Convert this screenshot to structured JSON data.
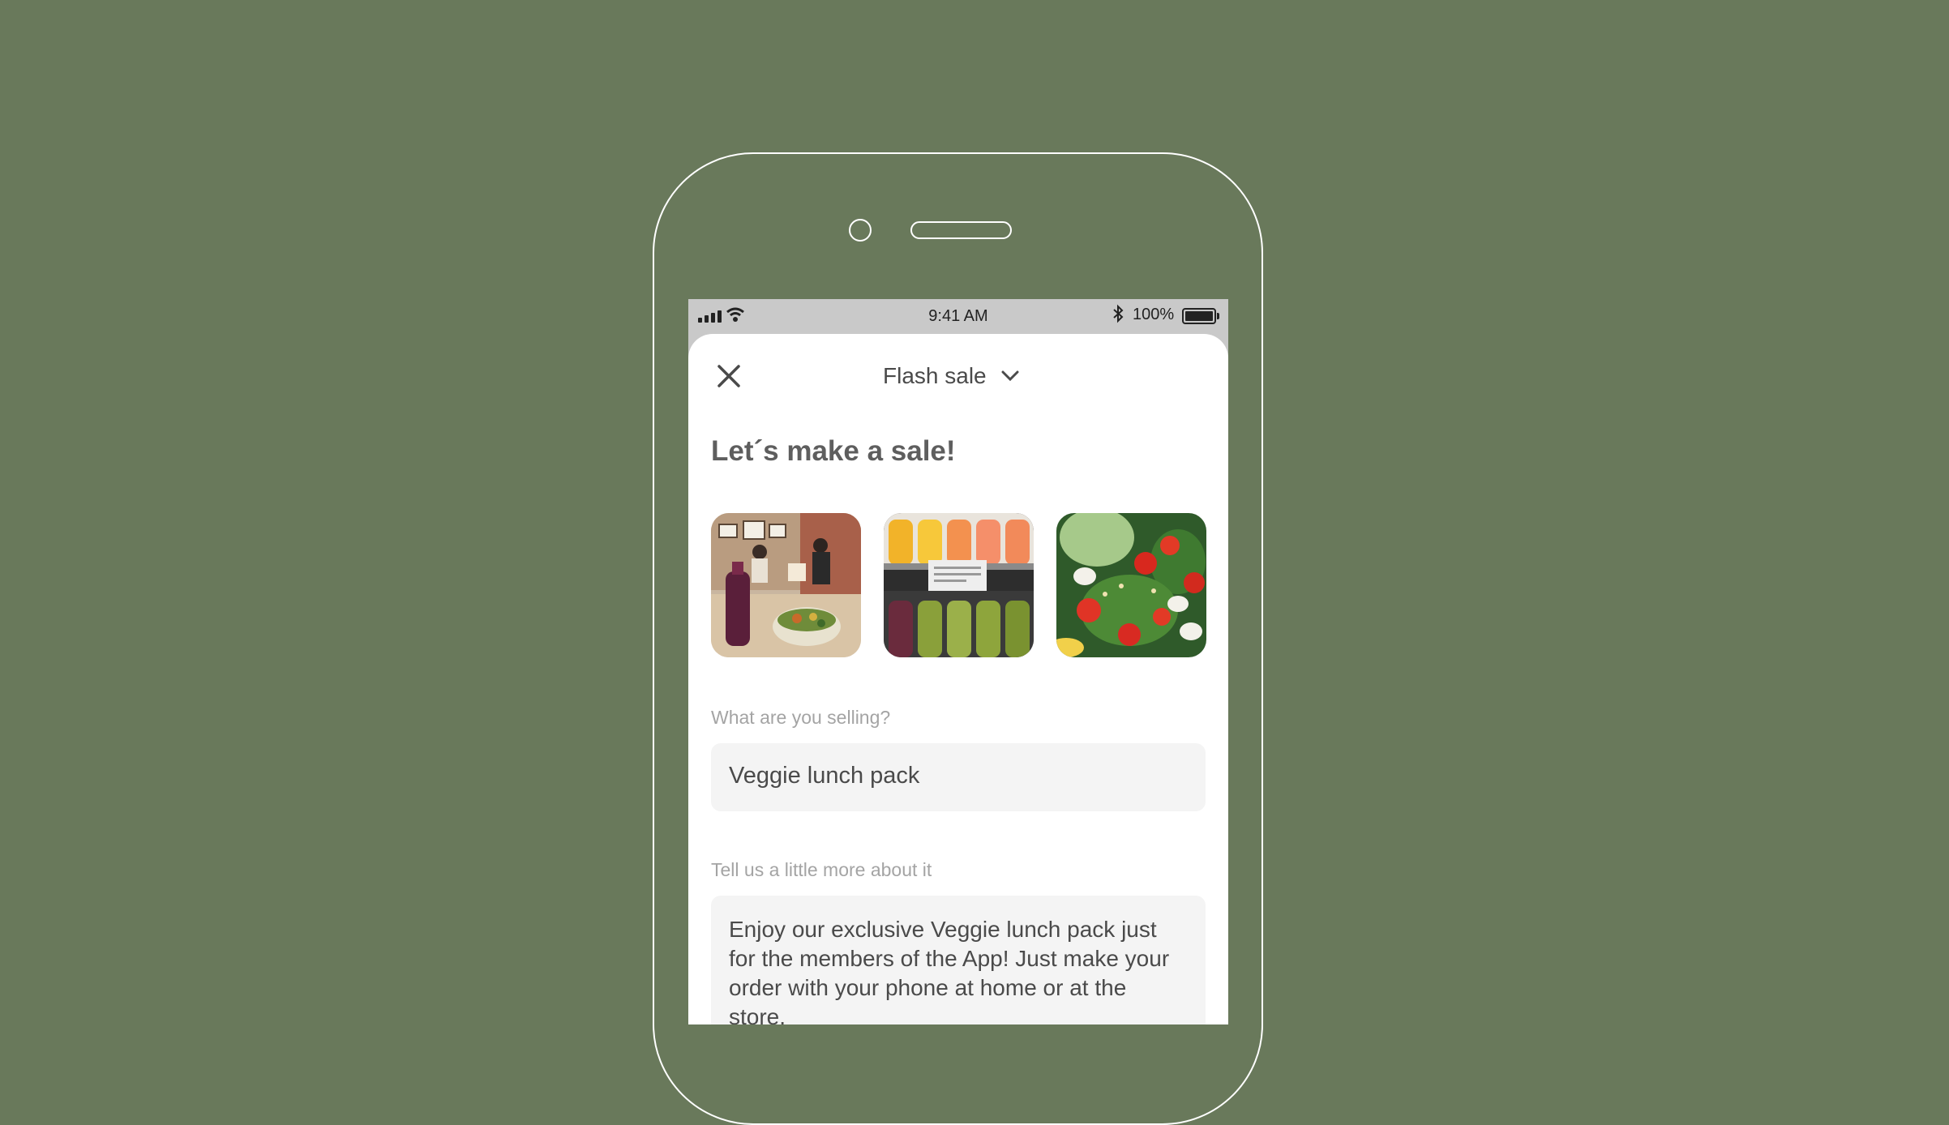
{
  "status_bar": {
    "time": "9:41 AM",
    "battery_percent": "100%",
    "signal_icon": "cellular-signal-icon",
    "wifi_icon": "wifi-icon",
    "bluetooth_icon": "bluetooth-icon",
    "battery_icon": "battery-icon"
  },
  "header": {
    "close_icon": "close-icon",
    "title": "Flash sale",
    "dropdown_icon": "chevron-down-icon"
  },
  "main": {
    "heading": "Let´s make a sale!",
    "photos": [
      {
        "name": "cafe-photo"
      },
      {
        "name": "juice-bottles-photo"
      },
      {
        "name": "salad-photo"
      }
    ],
    "product_field": {
      "label": "What are you selling?",
      "value": "Veggie lunch pack"
    },
    "description_field": {
      "label": "Tell us a little more about it",
      "value": "Enjoy our exclusive Veggie lunch pack just for the members of the App! Just make your order with your phone at home or at the store."
    }
  },
  "colors": {
    "background": "#69795b",
    "sheet": "#ffffff",
    "field_background": "#f4f4f4",
    "text": "#4a4a4a",
    "label": "#a4a4a4"
  }
}
